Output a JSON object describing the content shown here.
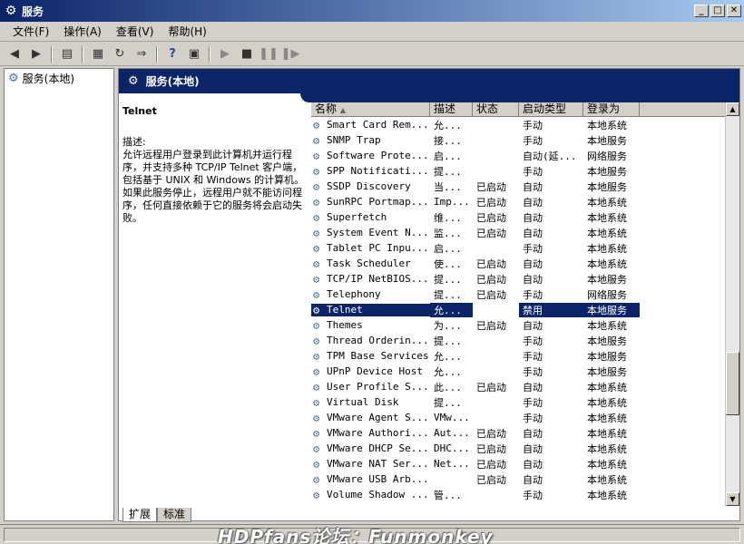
{
  "window": {
    "title": "服务",
    "icon": "gear-icon"
  },
  "menu": [
    "文件(F)",
    "操作(A)",
    "查看(V)",
    "帮助(H)"
  ],
  "tree": {
    "root_label": "服务(本地)"
  },
  "panel": {
    "header": "服务(本地)",
    "selected_title": "Telnet",
    "desc_label": "描述:",
    "desc_text": "允许远程用户登录到此计算机并运行程序，并支持多种 TCP/IP Telnet 客户端，包括基于 UNIX 和 Windows 的计算机。如果此服务停止，远程用户就不能访问程序，任何直接依赖于它的服务将会启动失败。"
  },
  "columns": [
    "名称",
    "描述",
    "状态",
    "启动类型",
    "登录为"
  ],
  "rows": [
    {
      "name": "Smart Card Rem...",
      "desc": "允...",
      "status": "",
      "start": "手动",
      "logon": "本地系统"
    },
    {
      "name": "SNMP Trap",
      "desc": "接...",
      "status": "",
      "start": "手动",
      "logon": "本地服务"
    },
    {
      "name": "Software Prote...",
      "desc": "启...",
      "status": "",
      "start": "自动(延...",
      "logon": "网络服务"
    },
    {
      "name": "SPP Notificati...",
      "desc": "提...",
      "status": "",
      "start": "手动",
      "logon": "本地服务"
    },
    {
      "name": "SSDP Discovery",
      "desc": "当...",
      "status": "已启动",
      "start": "自动",
      "logon": "本地服务"
    },
    {
      "name": "SunRPC Portmap...",
      "desc": "Imp...",
      "status": "已启动",
      "start": "自动",
      "logon": "本地系统"
    },
    {
      "name": "Superfetch",
      "desc": "维...",
      "status": "已启动",
      "start": "自动",
      "logon": "本地系统"
    },
    {
      "name": "System Event N...",
      "desc": "监...",
      "status": "已启动",
      "start": "自动",
      "logon": "本地系统"
    },
    {
      "name": "Tablet PC Inpu...",
      "desc": "启...",
      "status": "",
      "start": "手动",
      "logon": "本地系统"
    },
    {
      "name": "Task Scheduler",
      "desc": "使...",
      "status": "已启动",
      "start": "自动",
      "logon": "本地系统"
    },
    {
      "name": "TCP/IP NetBIOS...",
      "desc": "提...",
      "status": "已启动",
      "start": "自动",
      "logon": "本地服务"
    },
    {
      "name": "Telephony",
      "desc": "提...",
      "status": "已启动",
      "start": "手动",
      "logon": "网络服务"
    },
    {
      "name": "Telnet",
      "desc": "允...",
      "status": "",
      "start": "禁用",
      "logon": "本地服务",
      "selected": true
    },
    {
      "name": "Themes",
      "desc": "为...",
      "status": "已启动",
      "start": "自动",
      "logon": "本地系统"
    },
    {
      "name": "Thread Orderin...",
      "desc": "提...",
      "status": "",
      "start": "手动",
      "logon": "本地服务"
    },
    {
      "name": "TPM Base Services",
      "desc": "允...",
      "status": "",
      "start": "手动",
      "logon": "本地服务"
    },
    {
      "name": "UPnP Device Host",
      "desc": "允...",
      "status": "",
      "start": "手动",
      "logon": "本地服务"
    },
    {
      "name": "User Profile S...",
      "desc": "此...",
      "status": "已启动",
      "start": "自动",
      "logon": "本地系统"
    },
    {
      "name": "Virtual Disk",
      "desc": "提...",
      "status": "",
      "start": "手动",
      "logon": "本地系统"
    },
    {
      "name": "VMware Agent S...",
      "desc": "VMw...",
      "status": "",
      "start": "手动",
      "logon": "本地系统"
    },
    {
      "name": "VMware Authori...",
      "desc": "Aut...",
      "status": "已启动",
      "start": "自动",
      "logon": "本地系统"
    },
    {
      "name": "VMware DHCP Se...",
      "desc": "DHC...",
      "status": "已启动",
      "start": "自动",
      "logon": "本地系统"
    },
    {
      "name": "VMware NAT Ser...",
      "desc": "Net...",
      "status": "已启动",
      "start": "自动",
      "logon": "本地系统"
    },
    {
      "name": "VMware USB Arb...",
      "desc": "",
      "status": "已启动",
      "start": "自动",
      "logon": "本地系统"
    },
    {
      "name": "Volume Shadow ...",
      "desc": "管...",
      "status": "",
      "start": "手动",
      "logon": "本地系统"
    }
  ],
  "tabs": [
    "扩展",
    "标准"
  ],
  "watermark": "HDPfans论坛：Funmonkey"
}
